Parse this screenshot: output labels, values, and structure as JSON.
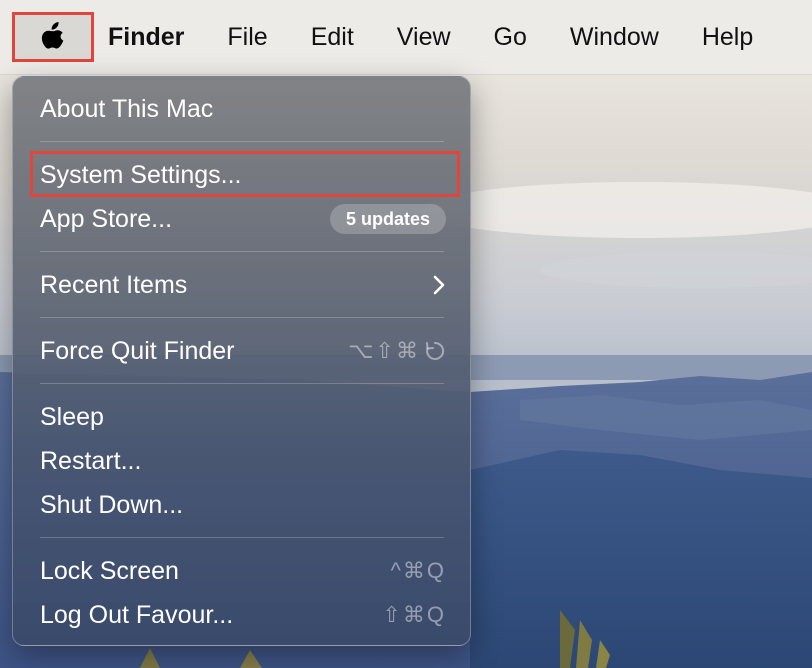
{
  "menubar": {
    "apple_icon": "apple-logo-icon",
    "items": [
      {
        "label": "Finder",
        "bold": true
      },
      {
        "label": "File"
      },
      {
        "label": "Edit"
      },
      {
        "label": "View"
      },
      {
        "label": "Go"
      },
      {
        "label": "Window"
      },
      {
        "label": "Help"
      }
    ]
  },
  "apple_menu": {
    "about": "About This Mac",
    "system_settings": "System Settings...",
    "app_store": "App Store...",
    "app_store_badge": "5 updates",
    "recent_items": "Recent Items",
    "force_quit": "Force Quit Finder",
    "force_quit_shortcut": "⌥⇧⌘",
    "sleep": "Sleep",
    "restart": "Restart...",
    "shut_down": "Shut Down...",
    "lock_screen": "Lock Screen",
    "lock_screen_shortcut": "^⌘Q",
    "log_out": "Log Out Favour...",
    "log_out_shortcut": "⇧⌘Q"
  },
  "colors": {
    "highlight_border": "#e0463a",
    "menubar_bg": "#ecebe7"
  }
}
